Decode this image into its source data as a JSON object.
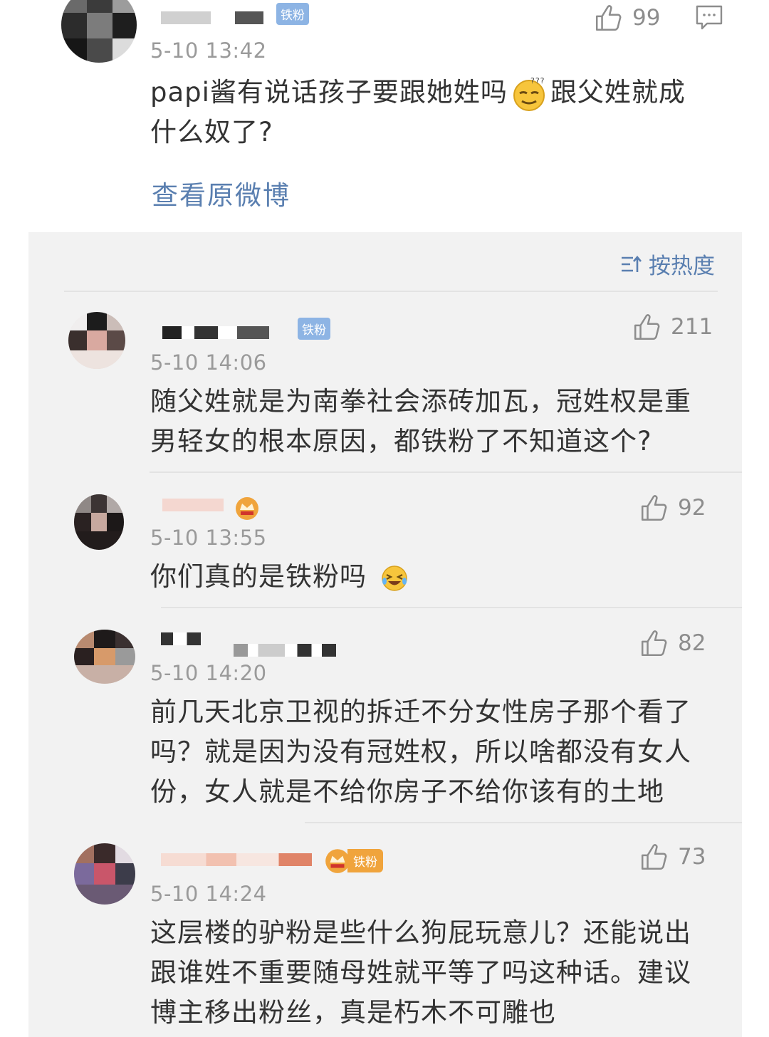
{
  "main": {
    "badge": "铁粉",
    "time": "5-10 13:42",
    "text_before": "papi酱有说话孩子要跟她姓吗",
    "text_after": "跟父姓就成什么奴了?",
    "likes": "99",
    "view_original": "查看原微博",
    "emoji_name": "thinking-face-emoji"
  },
  "sort": {
    "label": "按热度",
    "icon": "sort-icon"
  },
  "replies": [
    {
      "badge": "铁粉",
      "time": "5-10 14:06",
      "text": "随父姓就是为南拳社会添砖加瓦，冠姓权是重男轻女的根本原因，都铁粉了不知道这个?",
      "likes": "211"
    },
    {
      "badge": "",
      "time": "5-10 13:55",
      "text": "你们真的是铁粉吗",
      "likes": "92",
      "emoji_name": "laugh-cry-emoji"
    },
    {
      "badge": "",
      "time": "5-10 14:20",
      "text": "前几天北京卫视的拆迁不分女性房子那个看了吗？就是因为没有冠姓权，所以啥都没有女人份，女人就是不给你房子不给你该有的土地",
      "likes": "82"
    },
    {
      "badge": "铁粉",
      "time": "5-10 14:24",
      "text": "这层楼的驴粉是些什么狗屁玩意儿？还能说出跟谁姓不重要随母姓就平等了吗这种话。建议博主移出粉丝，真是朽木不可雕也",
      "likes": "73"
    }
  ],
  "colors": {
    "link": "#5a7fb0",
    "panel_bg": "#f2f2f2",
    "muted": "#9a9a9a",
    "badge_blue": "#8db4e4",
    "badge_gold": "#f0a43c"
  }
}
